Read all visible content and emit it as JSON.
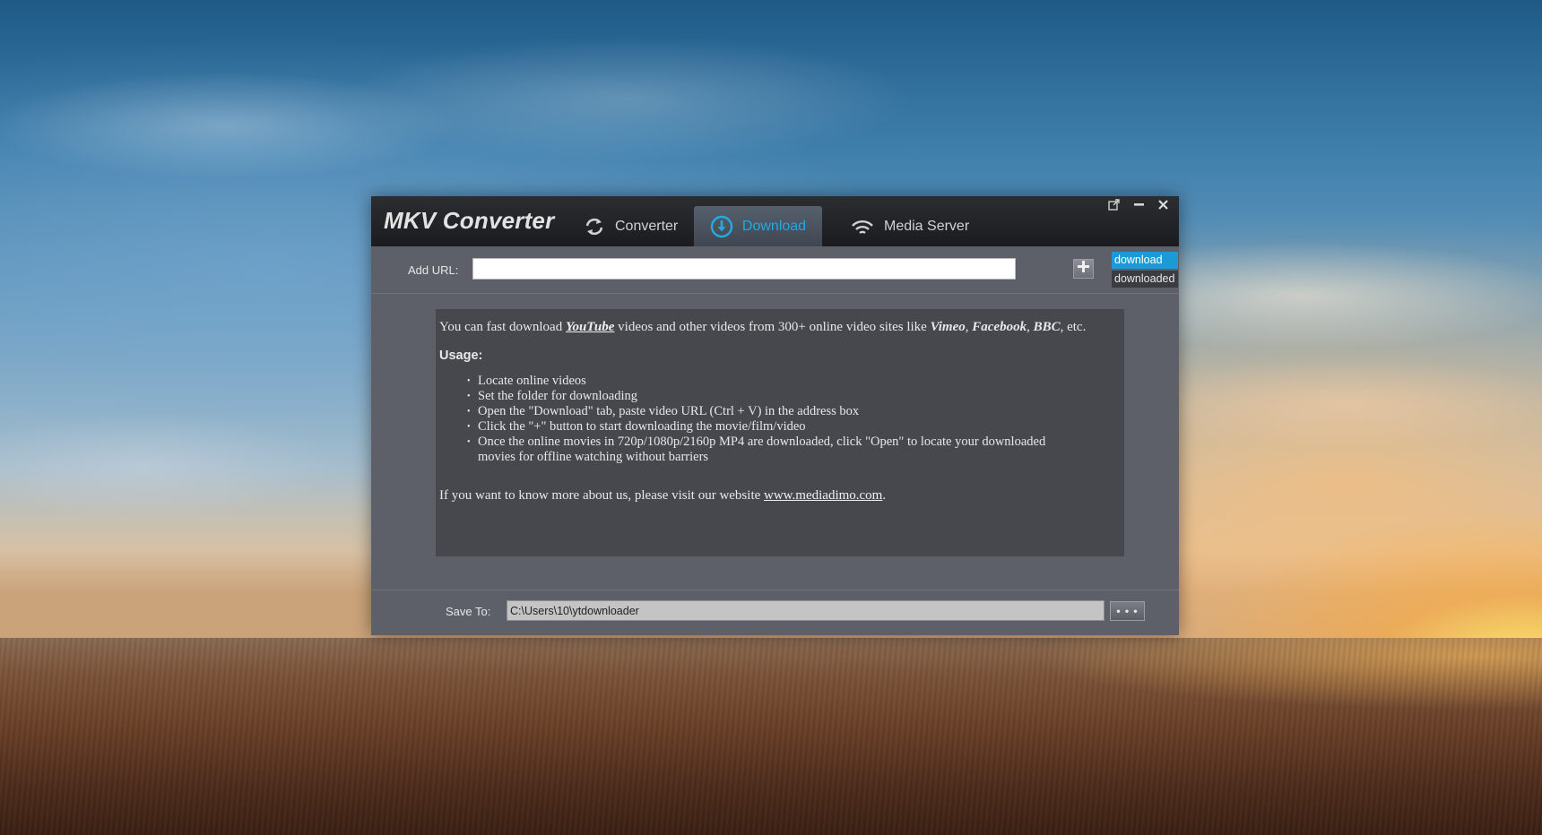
{
  "app": {
    "title": "MKV Converter",
    "accent_color": "#23a9e3",
    "tabs": [
      {
        "label": "Converter",
        "icon": "refresh-icon",
        "active": false
      },
      {
        "label": "Download",
        "icon": "download-circle-icon",
        "active": true
      },
      {
        "label": "Media Server",
        "icon": "wifi-icon",
        "active": false
      }
    ],
    "window_controls": {
      "popout_icon": "popout-icon",
      "minimize_icon": "minimize-icon",
      "close_icon": "close-icon"
    }
  },
  "url_row": {
    "label": "Add URL:",
    "value": "",
    "add_button_icon": "plus-icon"
  },
  "side_tabs": [
    {
      "label": "download",
      "selected": true
    },
    {
      "label": "downloaded",
      "selected": false
    }
  ],
  "info": {
    "intro_prefix": "You can fast download ",
    "intro_link": "YouTube",
    "intro_middle": " videos and other videos from 300+ online video sites like ",
    "site_1": "Vimeo",
    "sep_1": ", ",
    "site_2": "Facebook",
    "sep_2": ", ",
    "site_3": "BBC",
    "intro_suffix": ", etc.",
    "usage_heading": "Usage:",
    "usage_items": [
      "Locate online videos",
      "Set the folder for downloading",
      "Open the \"Download\" tab, paste video URL (Ctrl + V) in the address box",
      "Click the \"+\" button to start downloading the movie/film/video",
      "Once the online movies in 720p/1080p/2160p MP4 are downloaded, click \"Open\" to locate your downloaded movies for offline watching without barriers"
    ],
    "footer_prefix": "If you want to know more about us, please visit our website ",
    "footer_link": "www.mediadimo.com",
    "footer_suffix": "."
  },
  "save_row": {
    "label": "Save To:",
    "path": "C:\\Users\\10\\ytdownloader",
    "browse_label": "• • •"
  }
}
